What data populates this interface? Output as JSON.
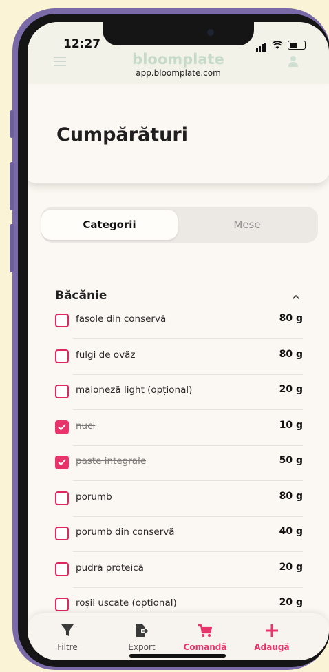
{
  "status_bar": {
    "time": "12:27"
  },
  "header": {
    "brand": "bloomplate",
    "url": "app.bloomplate.com"
  },
  "page": {
    "title": "Cumpărături"
  },
  "tabs": [
    {
      "label": "Categorii",
      "active": true
    },
    {
      "label": "Mese",
      "active": false
    }
  ],
  "section": {
    "title": "Băcănie",
    "expanded": true
  },
  "items": [
    {
      "name": "fasole din conservă",
      "qty": "80 g",
      "checked": false
    },
    {
      "name": "fulgi de ovăz",
      "qty": "80 g",
      "checked": false
    },
    {
      "name": "maioneză light (opțional)",
      "qty": "20 g",
      "checked": false
    },
    {
      "name": "nuci",
      "qty": "10 g",
      "checked": true
    },
    {
      "name": "paste integrale",
      "qty": "50 g",
      "checked": true
    },
    {
      "name": "porumb",
      "qty": "80 g",
      "checked": false
    },
    {
      "name": "porumb din conservă",
      "qty": "40 g",
      "checked": false
    },
    {
      "name": "pudră proteică",
      "qty": "20 g",
      "checked": false
    },
    {
      "name": "roșii uscate (opțional)",
      "qty": "20 g",
      "checked": false
    }
  ],
  "bottom_nav": [
    {
      "label": "Filtre",
      "icon": "filter-icon",
      "accent": false
    },
    {
      "label": "Export",
      "icon": "export-icon",
      "accent": false
    },
    {
      "label": "Comandă",
      "icon": "cart-icon",
      "accent": true
    },
    {
      "label": "Adaugă",
      "icon": "plus-icon",
      "accent": true
    }
  ],
  "colors": {
    "accent": "#e8346a",
    "background": "#fbf7f2",
    "page_bg": "#fbf3d6",
    "frame": "#7a6aa8"
  }
}
